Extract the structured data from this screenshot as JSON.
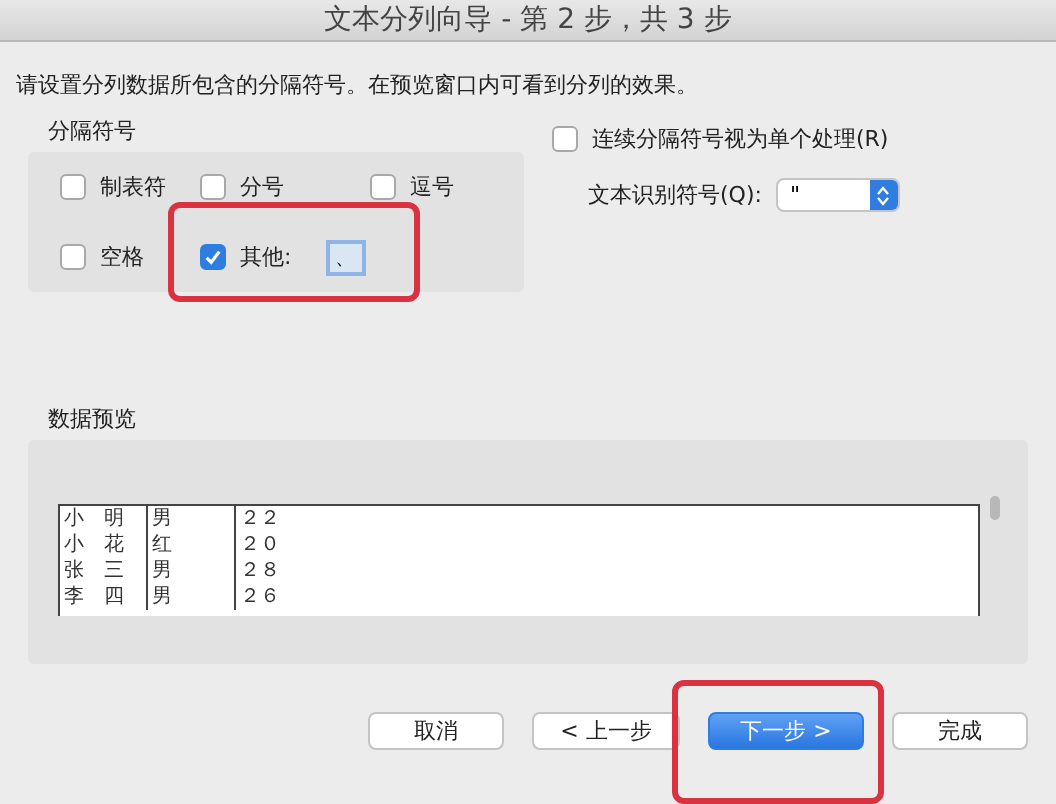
{
  "window": {
    "title": "文本分列向导 - 第 2 步，共 3 步"
  },
  "instruction": "请设置分列数据所包含的分隔符号。在预览窗口内可看到分列的效果。",
  "delimiters": {
    "title": "分隔符号",
    "options": [
      {
        "label": "制表符",
        "checked": false
      },
      {
        "label": "分号",
        "checked": false
      },
      {
        "label": "逗号",
        "checked": false
      },
      {
        "label": "空格",
        "checked": false
      },
      {
        "label": "其他:",
        "checked": true,
        "value": "、"
      }
    ]
  },
  "consecutive": {
    "label": "连续分隔符号视为单个处理(R)",
    "checked": false
  },
  "qualifier": {
    "label": "文本识别符号(Q):",
    "value": "\""
  },
  "preview": {
    "title": "数据预览",
    "rows": [
      [
        "小　明",
        "男",
        "２２"
      ],
      [
        "小　花",
        "红",
        "２０"
      ],
      [
        "张　三",
        "男",
        "２８"
      ],
      [
        "李　四",
        "男",
        "２６"
      ]
    ]
  },
  "buttons": [
    {
      "label": "取消",
      "primary": false
    },
    {
      "label": "< 上一步",
      "primary": false
    },
    {
      "label": "下一步 >",
      "primary": true
    },
    {
      "label": "完成",
      "primary": false
    }
  ],
  "annotations": [
    {
      "kind": "highlight"
    },
    {
      "kind": "highlight"
    }
  ]
}
